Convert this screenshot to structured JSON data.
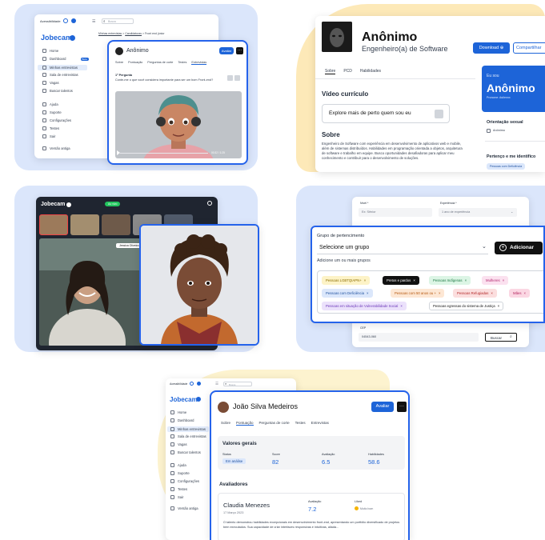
{
  "app": {
    "brand": "Jobecam",
    "availability": "Acessibilidade",
    "search_placeholder": "Busca"
  },
  "panel1": {
    "breadcrumb": [
      "Minhas entrevistas",
      "Candidaturas",
      "Front end júnior"
    ],
    "sidebar": [
      "Home",
      "Dashboard",
      "Minhas entrevistas",
      "Sala de entrevistas",
      "Vagas",
      "Buscar talentos",
      "Ajuda",
      "Suporte",
      "Configurações",
      "Testes",
      "Sair",
      "Versão antiga"
    ],
    "sidebar_badge": "Beta",
    "modal": {
      "name": "Anônimo",
      "avaliar": "Avaliar",
      "tabs": [
        "Sobre",
        "Pontuação",
        "Perguntas de corte",
        "Testes",
        "Entrevistas"
      ],
      "question_label": "1ª Pergunta",
      "question_text": "Conte-me o que você considera importante para ser um bom Front-end?",
      "video_time": "00:32 / 1:25"
    }
  },
  "panel2": {
    "name": "Anônimo",
    "role": "Engenheiro(a) de Software",
    "download": "Download",
    "share": "Compartilhar",
    "tabs": [
      "Sobre",
      "PCD",
      "Habilidades"
    ],
    "video_heading": "Vídeo currículo",
    "video_cta": "Explore mais de perto quem sou eu",
    "about_heading": "Sobre",
    "about_text": "Engenheiro de Software com experiência em desenvolvimento de aplicativos web e mobile, além de sistemas distribuídos. Habilidades em programação orientada a objetos, arquitetura de software e trabalho em equipe. Busco oportunidades desafiadoras para aplicar meu conhecimento e contribuir para o desenvolvimento de soluções.",
    "side_label": "Eu sou",
    "side_name": "Anônimo",
    "pronouns": "Pronome: Ast/ennx",
    "orientation_heading": "Orientação sexual",
    "orientation_value": "Anônimo",
    "belong_heading": "Pertenço e me identifico",
    "belong_value": "Pessoas com Deficiência"
  },
  "panel3": {
    "brand": "Jobecam",
    "live_label": "Ao vivo",
    "speaker_tag": "Jessica Oliveira"
  },
  "panel4": {
    "field_level_label": "Nível *",
    "field_level_value": "Ex: Sênior",
    "field_exp_label": "Experiência *",
    "field_exp_value": "1 ano de experiência",
    "group_label": "Grupo de pertencimento",
    "group_placeholder": "Selecione um grupo",
    "add_button": "Adicionar",
    "hint": "Adicione um ou mais grupos",
    "tags": [
      {
        "label": "Pessoas LGBTQIAPN+",
        "bg": "#fdf3c7",
        "fg": "#8a6d00"
      },
      {
        "label": "Pretos e pardos",
        "bg": "#111111",
        "fg": "#ffffff"
      },
      {
        "label": "Pessoas Indígenas",
        "bg": "#dcf5e5",
        "fg": "#1e7a45"
      },
      {
        "label": "Mulheres",
        "bg": "#fbe1ef",
        "fg": "#b3266f"
      },
      {
        "label": "Pessoas com Deficiência",
        "bg": "#dbe7fb",
        "fg": "#1d4f9e"
      },
      {
        "label": "Pessoas com 50 anos ou +",
        "bg": "#fde7d4",
        "fg": "#b4560e"
      },
      {
        "label": "Pessoas Refugiadas",
        "bg": "#fbdede",
        "fg": "#b32a2a"
      },
      {
        "label": "Mães",
        "bg": "#fbd7e3",
        "fg": "#b3265f"
      },
      {
        "label": "Pessoas em situação de Vulnerabilidade Social",
        "bg": "#ebe1fb",
        "fg": "#6a35b8"
      },
      {
        "label": "Pessoas egressas do sistema de Justiça",
        "bg": "#ffffff",
        "fg": "#111111"
      }
    ],
    "cep_label": "CEP",
    "cep_value": "04543-060",
    "search_button": "Buscar"
  },
  "panel5": {
    "sidebar": [
      "Home",
      "Dashboard",
      "Minhas entrevistas",
      "Sala de entrevistas",
      "Vagas",
      "Buscar talentos",
      "Ajuda",
      "Suporte",
      "Configurações",
      "Testes",
      "Sair",
      "Versão antiga"
    ],
    "name": "João Silva Medeiros",
    "avaliar": "Avaliar",
    "tabs": [
      "Sobre",
      "Pontuação",
      "Perguntas de corte",
      "Testes",
      "Entrevistas"
    ],
    "general_heading": "Valores gerais",
    "metrics": [
      {
        "label": "Status",
        "value": "Em análise"
      },
      {
        "label": "Score",
        "value": "82"
      },
      {
        "label": "Avaliação",
        "value": "6.5"
      },
      {
        "label": "Habilidades",
        "value": "58.6"
      }
    ],
    "reviewers_heading": "Avaliadores",
    "reviewer_name": "Claudia Menezes",
    "reviewer_date": "17 Março 2023",
    "reviewer_eval_label": "Avaliação",
    "reviewer_eval_value": "7.2",
    "reviewer_liked_label": "Liked",
    "reviewer_liked_value": "Muito bom",
    "reviewer_text": "O talento demonstrou habilidades excepcionais em desenvolvimento front-end, apresentando um portfólio diversificado de projetos bem executados. Sua capacidade de criar interfaces responsivas e intuitivas, aliada..."
  }
}
